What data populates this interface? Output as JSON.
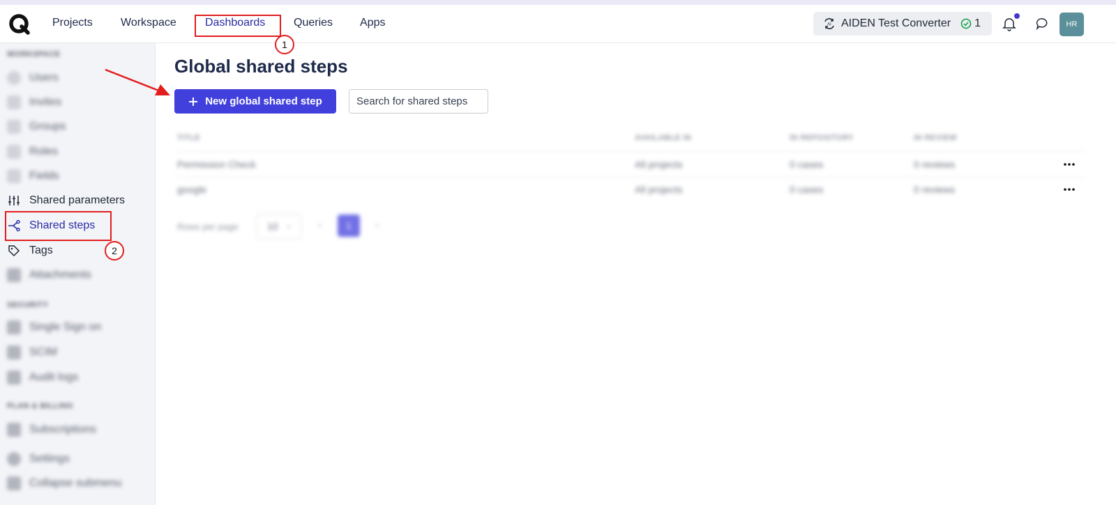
{
  "header": {
    "nav": [
      "Projects",
      "Workspace",
      "Dashboards",
      "Queries",
      "Apps"
    ],
    "active_nav": "Dashboards",
    "converter": {
      "label": "AIDEN Test Converter",
      "count": "1"
    },
    "avatar_initials": "HR"
  },
  "sidebar": {
    "section_workspace": "WORKSPACE",
    "items_top": [
      "Users",
      "Invites",
      "Groups",
      "Roles",
      "Fields"
    ],
    "shared_parameters": "Shared parameters",
    "shared_steps": "Shared steps",
    "tags": "Tags",
    "attachments": "Attachments",
    "section_security": "SECURITY",
    "items_security": [
      "Single Sign on",
      "SCIM",
      "Audit logs"
    ],
    "section_plan": "PLAN & BILLING",
    "items_plan": [
      "Subscriptions",
      "Settings",
      "Collapse submenu"
    ]
  },
  "main": {
    "title": "Global shared steps",
    "new_button": "New global shared step",
    "search_placeholder": "Search for shared steps",
    "columns": [
      "TITLE",
      "AVAILABLE IN",
      "IN REPOSITORY",
      "IN REVIEW"
    ],
    "rows": [
      [
        "Permission Check",
        "All projects",
        "0 cases",
        "0 reviews"
      ],
      [
        "google",
        "All projects",
        "0 cases",
        "0 reviews"
      ]
    ],
    "pager": {
      "rows_label": "Rows per page",
      "rows_value": "10",
      "page": "1"
    }
  },
  "annotations": {
    "step1": "1",
    "step2": "2"
  },
  "colors": {
    "primary": "#4240dc",
    "annotation": "#e11d1d",
    "avatar": "#5b8f99"
  }
}
